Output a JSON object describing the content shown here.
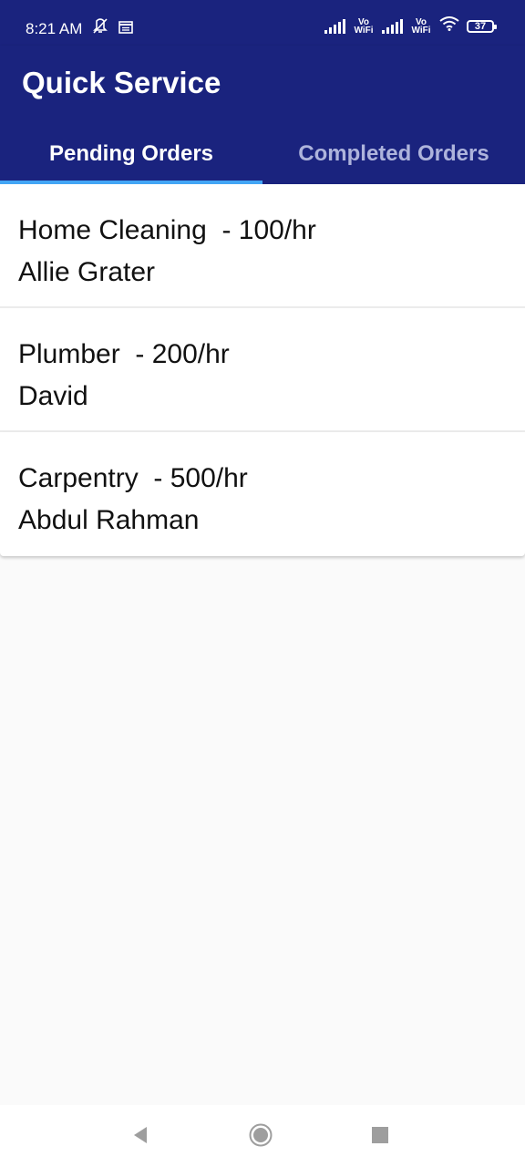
{
  "status_bar": {
    "time": "8:21 AM",
    "vowifi_label": "Vo WiFi",
    "battery": "37"
  },
  "app": {
    "title": "Quick Service"
  },
  "tabs": [
    {
      "label": "Pending Orders",
      "active": true
    },
    {
      "label": "Completed Orders",
      "active": false
    }
  ],
  "orders": [
    {
      "service": "Home Cleaning  - 100/hr",
      "customer": "Allie Grater"
    },
    {
      "service": "Plumber  - 200/hr",
      "customer": "David"
    },
    {
      "service": "Carpentry  - 500/hr",
      "customer": "Abdul Rahman"
    }
  ],
  "icons": {
    "mute": "mute-icon",
    "calendar": "calendar-icon",
    "signal": "signal-icon",
    "wifi": "wifi-icon",
    "battery": "battery-icon",
    "back": "back-triangle-icon",
    "home": "home-circle-icon",
    "recents": "recents-square-icon"
  },
  "colors": {
    "primary": "#1a237e",
    "tab_indicator": "#42a5f5",
    "inactive_tab": "#aeb4dc",
    "background": "#fafafa"
  }
}
